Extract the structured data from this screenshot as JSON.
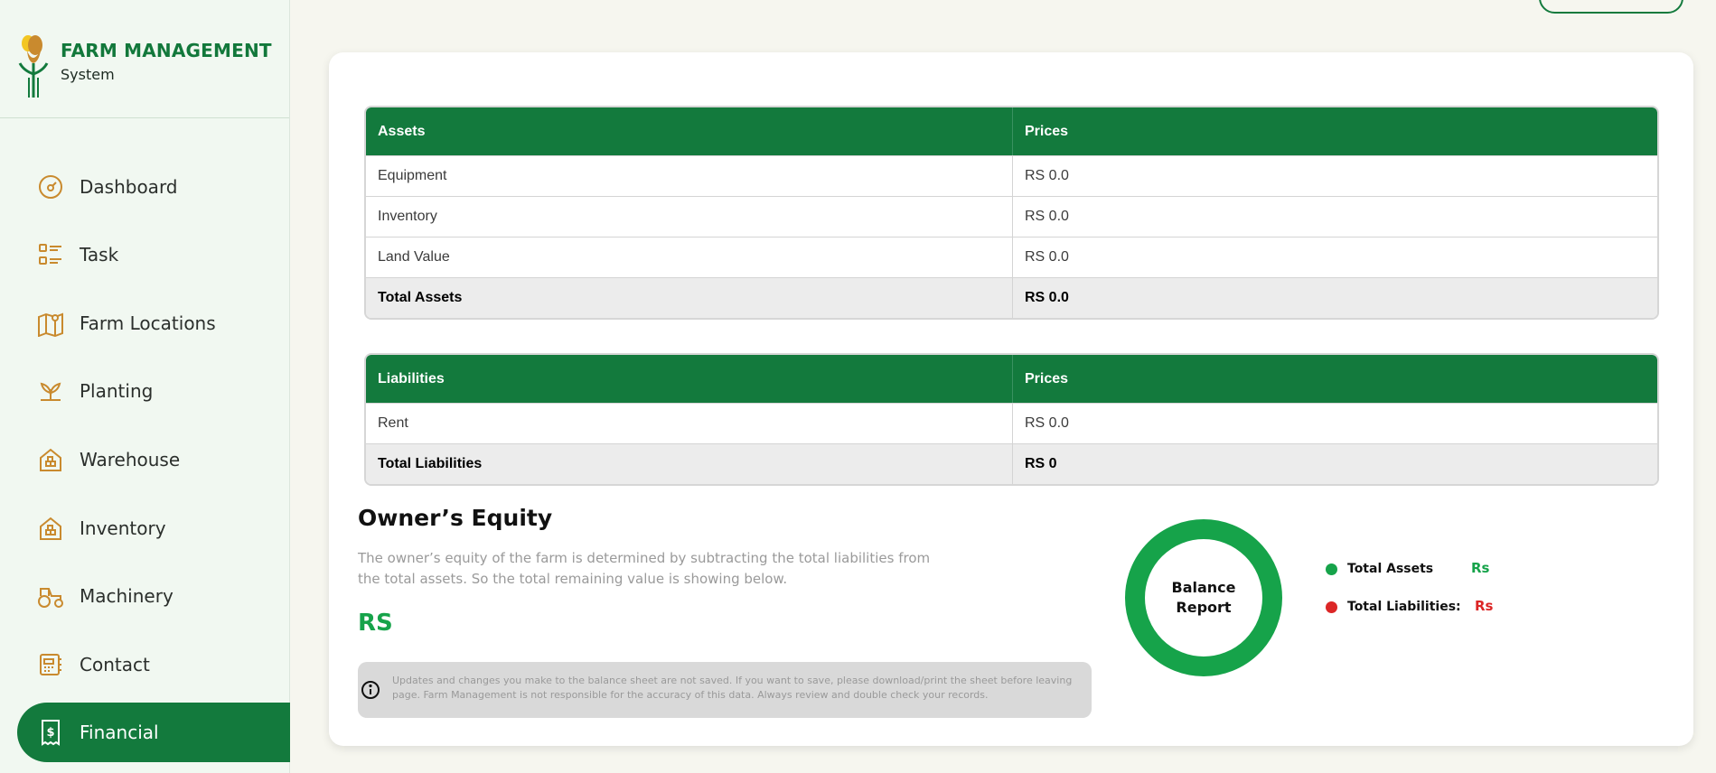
{
  "brand": {
    "title": "FARM MANAGEMENT",
    "subtitle": "System"
  },
  "sidebar": {
    "items": [
      {
        "label": "Dashboard",
        "icon": "dashboard-gauge-icon"
      },
      {
        "label": "Task",
        "icon": "task-list-icon"
      },
      {
        "label": "Farm Locations",
        "icon": "map-pin-icon"
      },
      {
        "label": "Planting",
        "icon": "sprout-icon"
      },
      {
        "label": "Warehouse",
        "icon": "warehouse-icon"
      },
      {
        "label": "Inventory",
        "icon": "inventory-icon"
      },
      {
        "label": "Machinery",
        "icon": "tractor-icon"
      },
      {
        "label": "Contact",
        "icon": "contact-book-icon"
      },
      {
        "label": "Financial",
        "icon": "receipt-dollar-icon",
        "active": true
      }
    ]
  },
  "assets_table": {
    "headers": [
      "Assets",
      "Prices"
    ],
    "rows": [
      [
        "Equipment",
        "RS 0.0"
      ],
      [
        "Inventory",
        "RS 0.0"
      ],
      [
        "Land Value",
        "RS 0.0"
      ]
    ],
    "total": [
      "Total Assets",
      "RS 0.0"
    ]
  },
  "liabilities_table": {
    "headers": [
      "Liabilities",
      "Prices"
    ],
    "rows": [
      [
        "Rent",
        "RS 0.0"
      ]
    ],
    "total": [
      "Total Liabilities",
      "RS 0"
    ]
  },
  "equity": {
    "title": "Owner’s Equity",
    "description": "The owner’s equity of the farm is determined by subtracting the total liabilities from the total assets. So the total remaining value is showing below.",
    "value": "RS"
  },
  "notice": {
    "text": "Updates and changes you make to the balance sheet are not saved. If you want to save, please download/print the sheet before leaving page. Farm Management is not responsible for the accuracy of this data. Always review and double check your records."
  },
  "report": {
    "chart_label_line1": "Balance",
    "chart_label_line2": "Report",
    "legend": [
      {
        "label": "Total Assets",
        "value": "Rs",
        "color": "#16a34a"
      },
      {
        "label": "Total Liabilities:",
        "value": "Rs",
        "color": "#dc2626"
      }
    ]
  },
  "colors": {
    "primary": "#137a3d",
    "accent_green": "#16a34a",
    "accent_red": "#dc2626",
    "icon_gold": "#c98a2e"
  }
}
